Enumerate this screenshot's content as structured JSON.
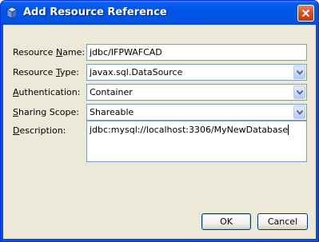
{
  "window": {
    "title": "Add Resource Reference"
  },
  "form": {
    "resource_name": {
      "label_mnemonic": "N",
      "label_pre": "Resource ",
      "label_post": "ame:",
      "value": "jdbc/IFPWAFCAD"
    },
    "resource_type": {
      "label_pre": "Resource ",
      "label_mnemonic": "T",
      "label_post": "ype:",
      "value": "javax.sql.DataSource"
    },
    "authentication": {
      "label_mnemonic": "A",
      "label_post": "uthentication:",
      "value": "Container"
    },
    "sharing_scope": {
      "label_mnemonic": "S",
      "label_post": "haring Scope:",
      "value": "Shareable"
    },
    "description": {
      "label_mnemonic": "D",
      "label_post": "escription:",
      "value": "jdbc:mysql://localhost:3306/MyNewDatabase"
    }
  },
  "buttons": {
    "ok": "OK",
    "cancel": "Cancel"
  },
  "icons": {
    "title": "netbeans-cube-icon",
    "close": "close-x-icon",
    "dropdown": "chevron-down-icon"
  },
  "colors": {
    "titlebar": "#0055e5",
    "dialog_bg": "#ece9d8",
    "close_button": "#d54d24",
    "field_border": "#7f9db9"
  }
}
